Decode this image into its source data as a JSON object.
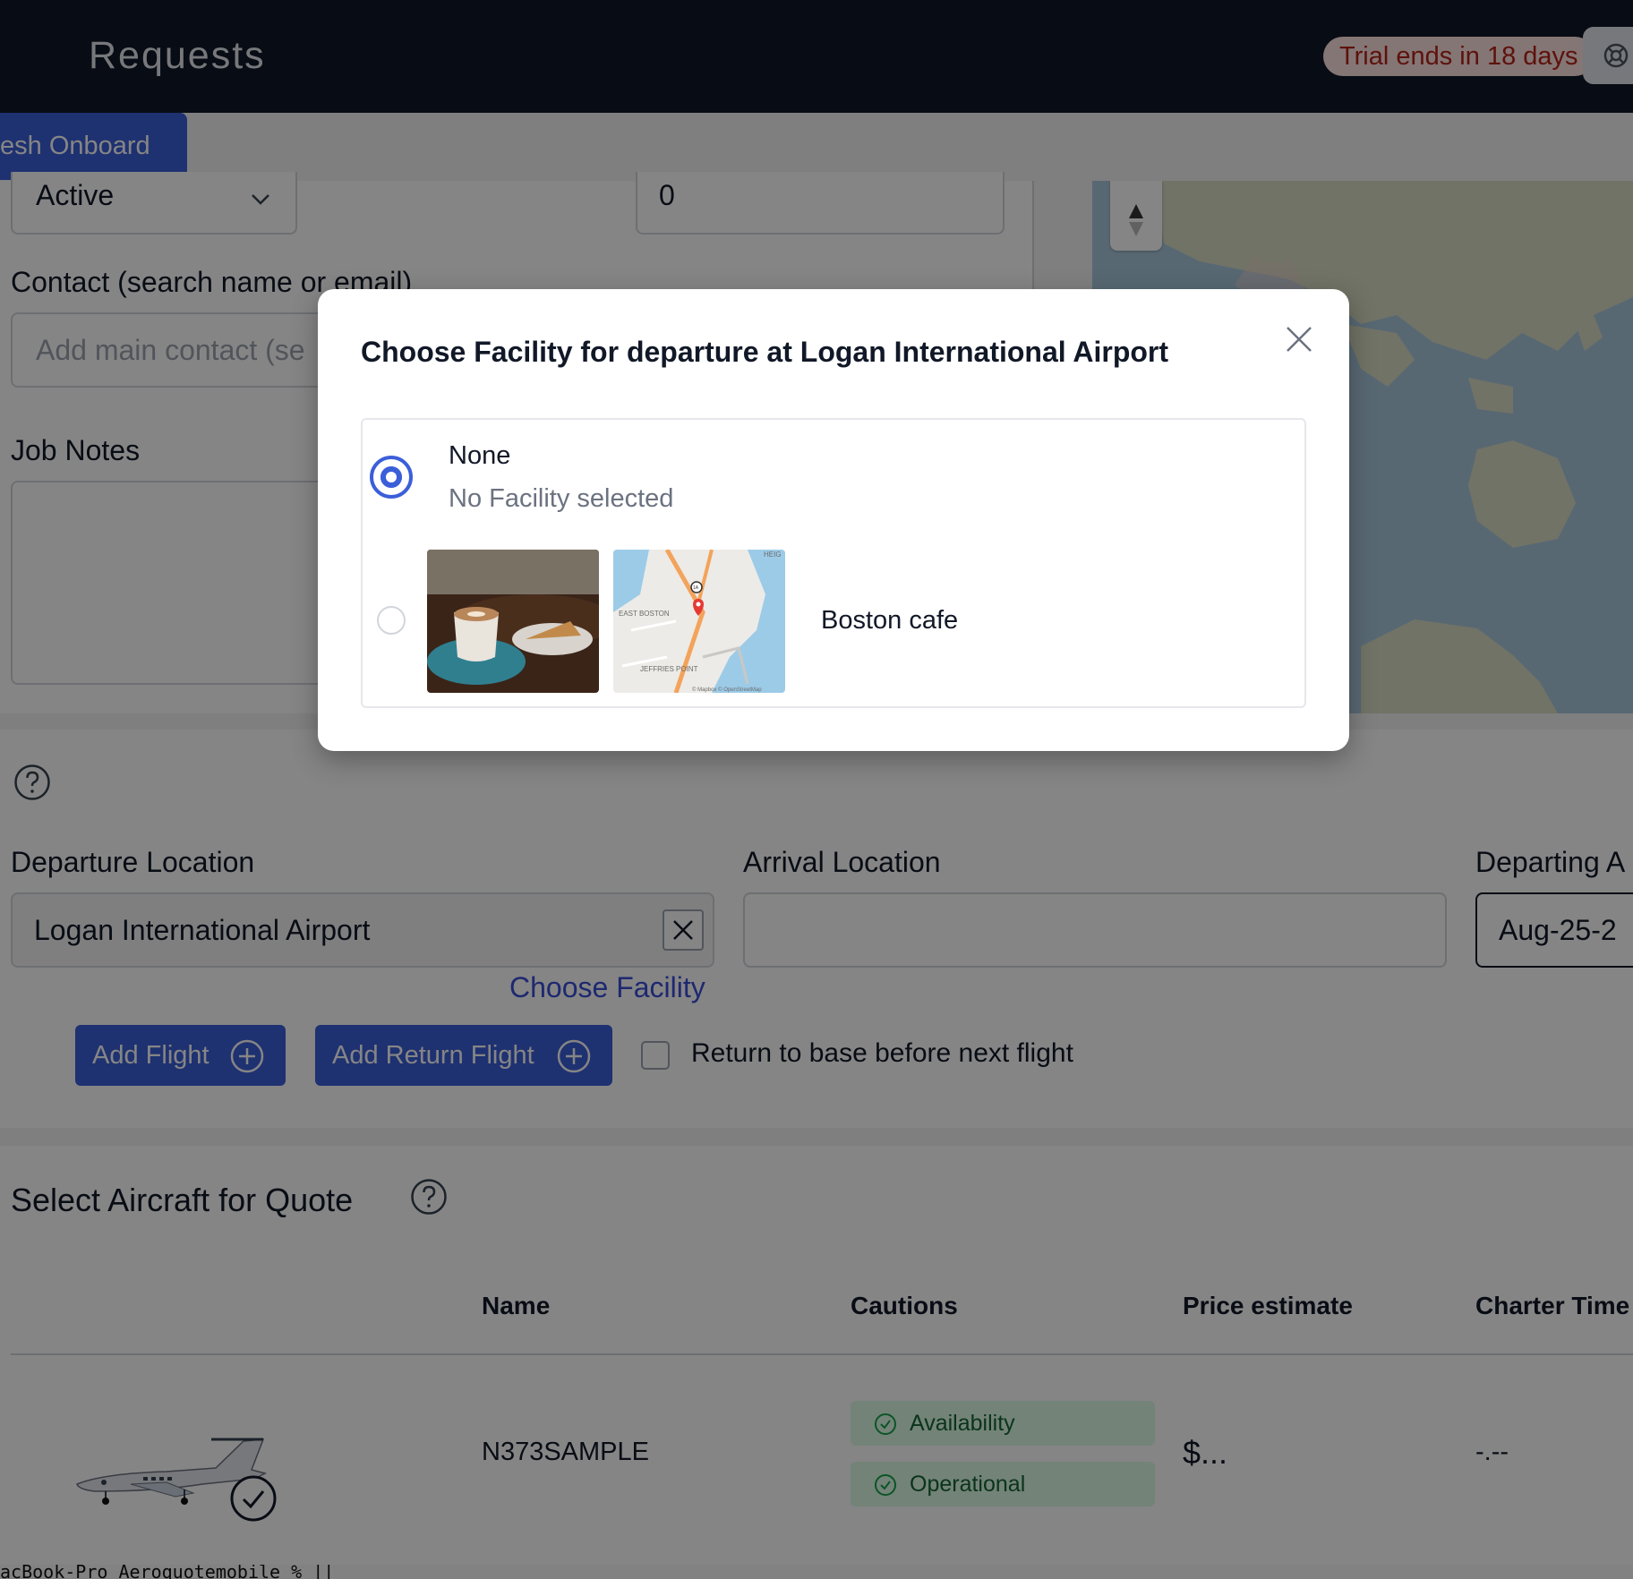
{
  "header": {
    "title": "Requests",
    "trial_badge": "Trial ends in 18 days"
  },
  "subbar": {
    "refresh_button": "esh Onboard"
  },
  "request_form": {
    "status_value": "Active",
    "number_value": "0",
    "contact_label": "Contact (search name or email)",
    "contact_placeholder": "Add main contact (se",
    "job_notes_label": "Job Notes"
  },
  "flights": {
    "departure_label": "Departure Location",
    "departure_value": "Logan International Airport",
    "arrival_label": "Arrival Location",
    "arrival_value": "",
    "departing_label": "Departing A",
    "departing_value": "Aug-25-2",
    "choose_facility_link": "Choose Facility",
    "add_flight_button": "Add Flight",
    "add_return_flight_button": "Add Return Flight",
    "return_to_base_label": "Return to base before next flight",
    "return_to_base_checked": false
  },
  "aircraft": {
    "section_title": "Select Aircraft for Quote",
    "columns": [
      "Name",
      "Cautions",
      "Price estimate",
      "Charter Time"
    ],
    "rows": [
      {
        "name": "N373SAMPLE",
        "cautions": [
          "Availability",
          "Operational"
        ],
        "price": "$...",
        "charter_time": "-.--"
      }
    ]
  },
  "terminal_line": "acBook-Pro Aeroquotemobile % ||",
  "modal": {
    "title": "Choose Facility for departure at Logan International Airport",
    "options": [
      {
        "title": "None",
        "subtitle": "No Facility selected",
        "selected": true
      },
      {
        "title": "Boston cafe",
        "selected": false
      }
    ],
    "map_labels": {
      "east_boston": "EAST BOSTON",
      "jeffries_point": "JEFFRIES POINT",
      "heights": "HEIG",
      "route": "1A",
      "attribution": "© Mapbox © OpenStreetMap"
    }
  },
  "colors": {
    "primary": "#3b5fd9",
    "header_bg": "#101828",
    "trial_bg": "#fde2e1",
    "trial_text": "#b42318",
    "link": "#3b4ed8",
    "pill_bg": "#dcfce7",
    "pill_text": "#166534"
  }
}
